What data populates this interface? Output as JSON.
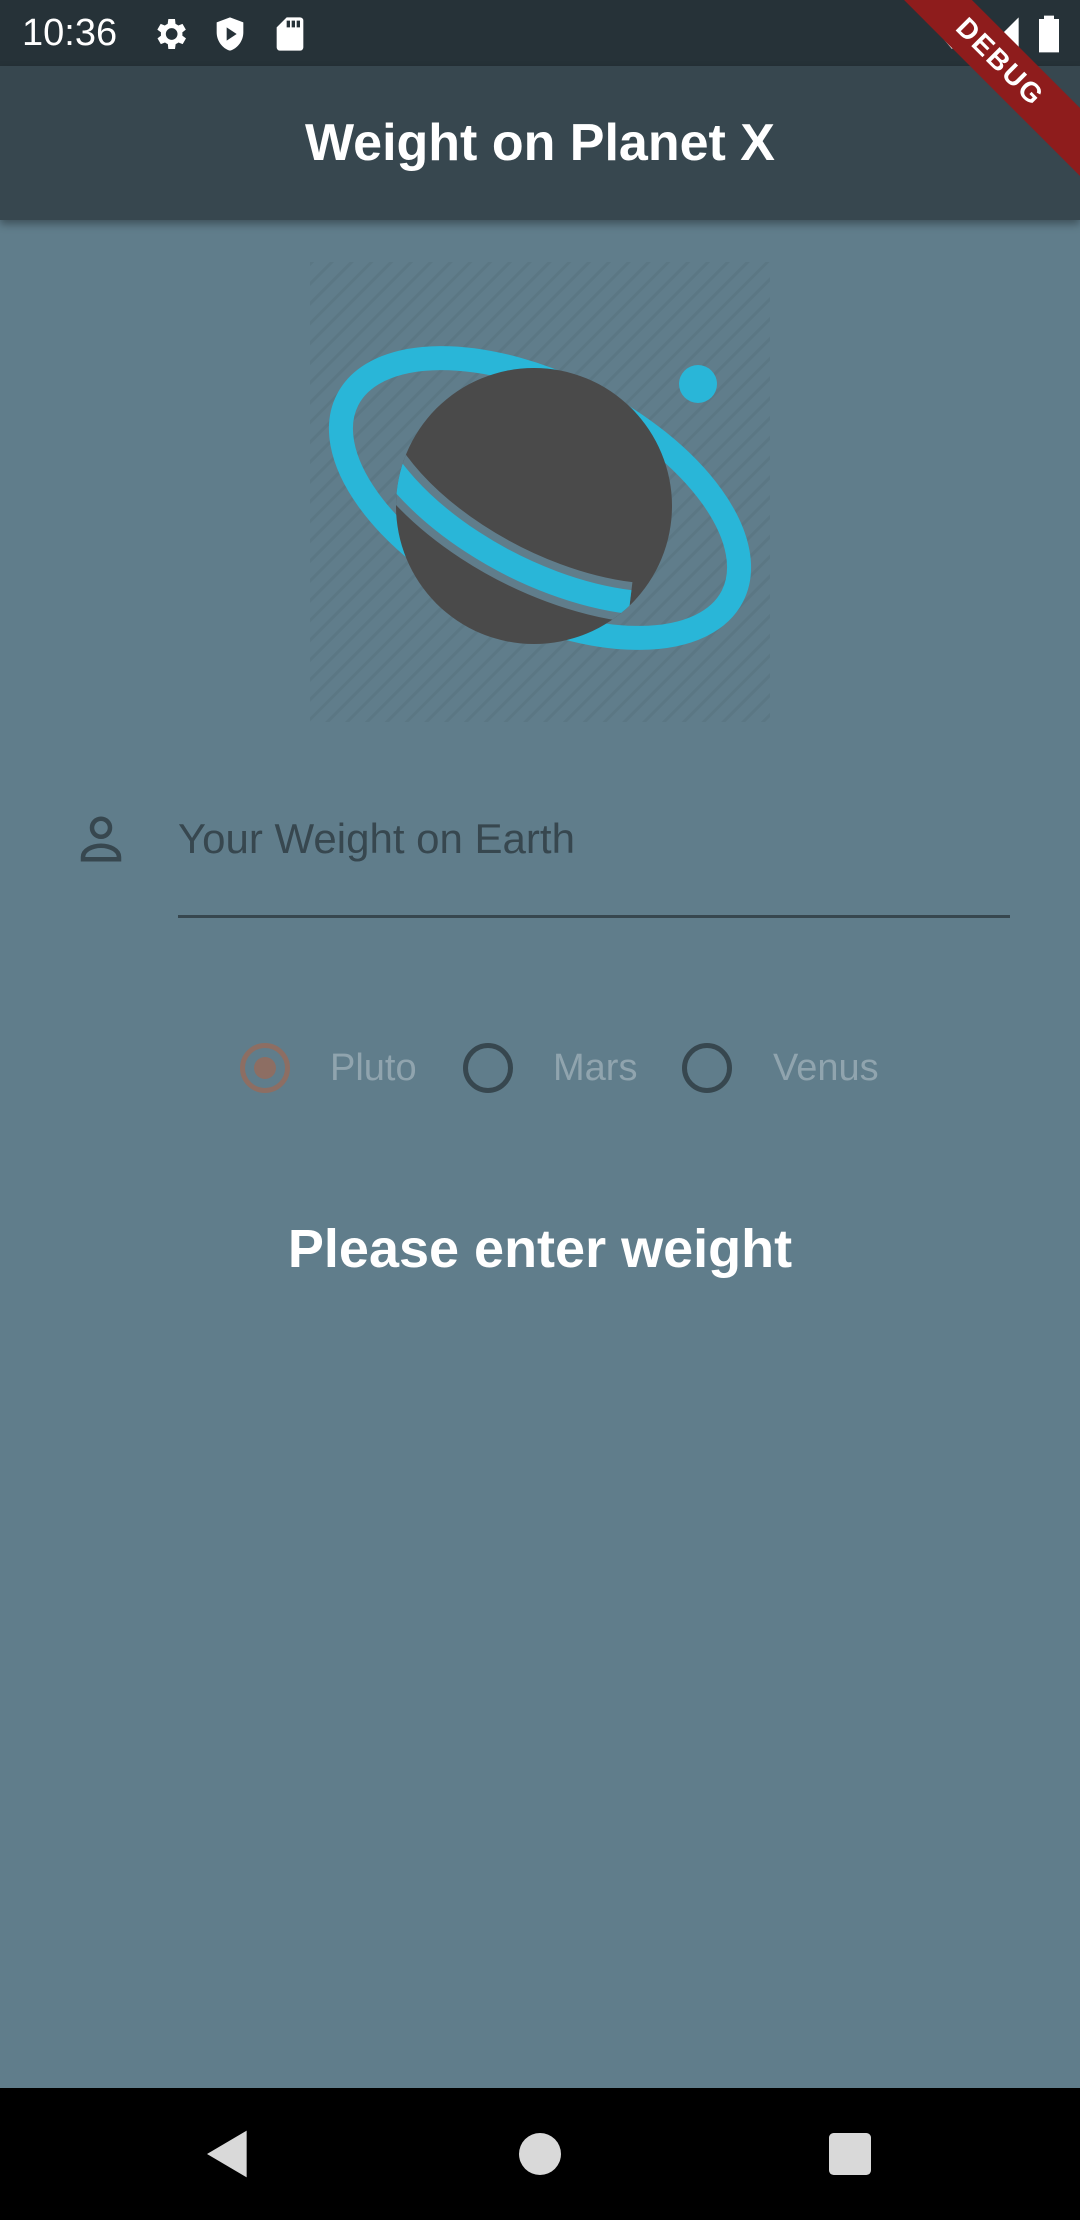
{
  "status_bar": {
    "time": "10:36",
    "left_icons": [
      "settings-icon",
      "shield-play-icon",
      "sd-card-icon"
    ],
    "right_icons": [
      "wifi-icon",
      "cell-signal-icon",
      "battery-icon"
    ]
  },
  "app_bar": {
    "title": "Weight on Planet X"
  },
  "debug_banner": "DEBUG",
  "weight_input": {
    "icon": "person-outline-icon",
    "placeholder": "Your Weight on Earth",
    "value": ""
  },
  "planets": {
    "selected": "Pluto",
    "options": [
      "Pluto",
      "Mars",
      "Venus"
    ]
  },
  "result": {
    "message": "Please enter weight"
  },
  "colors": {
    "background": "#607d8b",
    "app_bar": "#37474f",
    "status_bar": "#263238",
    "radio_selected": "#8d6e63",
    "planet_ring": "#29b6d8",
    "planet_body": "#4a4a4a"
  },
  "nav_bar": {
    "buttons": [
      "back-icon",
      "home-icon",
      "recents-icon"
    ]
  }
}
